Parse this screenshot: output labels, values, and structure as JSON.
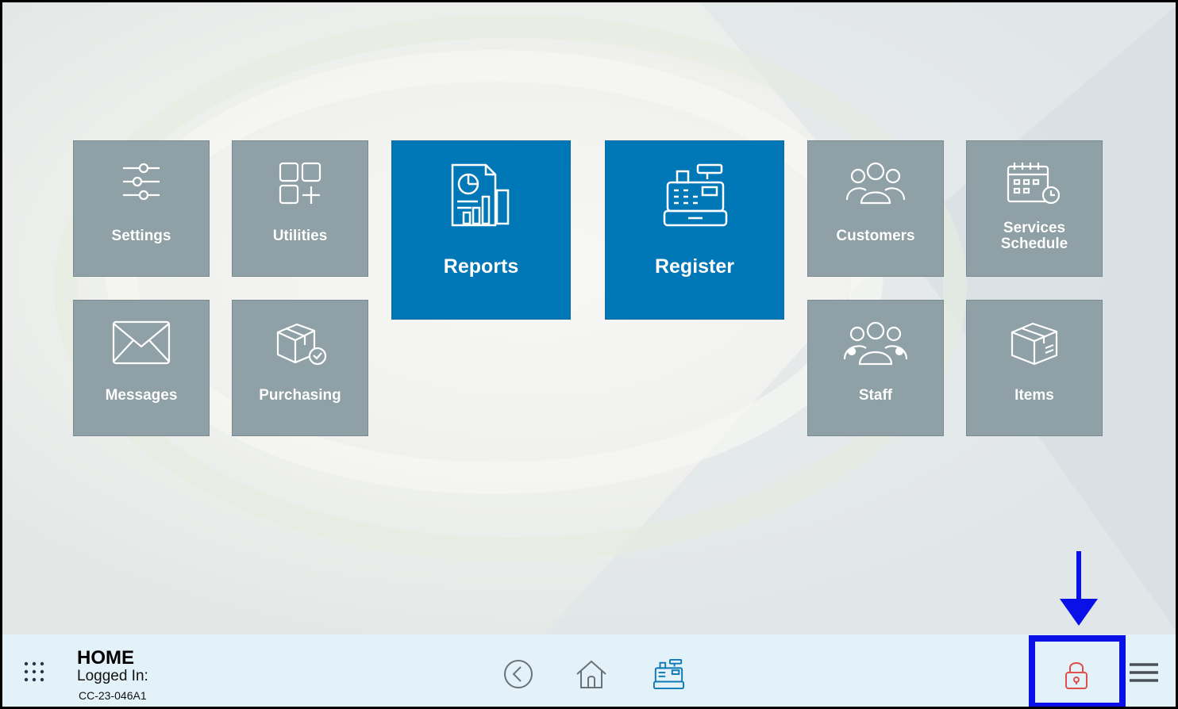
{
  "tiles": {
    "settings": "Settings",
    "utilities": "Utilities",
    "reports": "Reports",
    "register": "Register",
    "customers": "Customers",
    "services_schedule_line1": "Services",
    "services_schedule_line2": "Schedule",
    "messages": "Messages",
    "purchasing": "Purchasing",
    "staff": "Staff",
    "items": "Items"
  },
  "status_bar": {
    "title": "HOME",
    "logged_in_label": "Logged In:",
    "station_id": "CC-23-046A1"
  },
  "colors": {
    "tile_gray": "#8fa1a6",
    "tile_blue": "#0078b8",
    "bottom_bar": "#e3f1f9",
    "lock_icon": "#e0504a",
    "highlight": "#0a10e8"
  },
  "icons": {
    "bottom_left": "apps-grid-icon",
    "back": "back-circle-icon",
    "home": "home-icon",
    "register": "cash-register-icon",
    "lock": "lock-icon",
    "menu": "hamburger-menu-icon"
  }
}
